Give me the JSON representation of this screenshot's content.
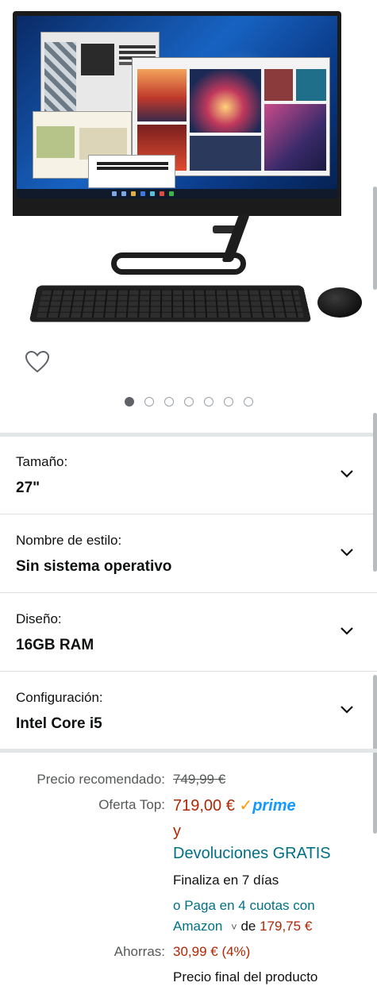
{
  "carousel": {
    "image_count": 7,
    "active_index": 0
  },
  "variations": [
    {
      "label": "Tamaño:",
      "value": "27\""
    },
    {
      "label": "Nombre de estilo:",
      "value": "Sin sistema operativo"
    },
    {
      "label": "Diseño:",
      "value": "16GB RAM"
    },
    {
      "label": "Configuración:",
      "value": "Intel Core i5"
    }
  ],
  "price": {
    "list_label": "Precio recomendado:",
    "list_price": "749,99 €",
    "deal_label": "Oferta Top:",
    "deal_price": "719,00 €",
    "prime_check": "✓",
    "prime_word": "prime",
    "and_text": "y",
    "returns_link": "Devoluciones GRATIS",
    "ends_text": "Finaliza en 7 días",
    "installments_prefix": "o",
    "installments_link_line1": "Paga en 4 cuotas con",
    "installments_link_line2": "Amazon",
    "installments_of": "de",
    "installments_amount": "179,75 €",
    "savings_label": "Ahorras:",
    "savings_value": "30,99 € (4%)",
    "final_price_text": "Precio final del producto"
  },
  "colors": {
    "price_red": "#b12704",
    "link_teal": "#007185",
    "prime_blue": "#1399ff",
    "prime_orange": "#ff9900"
  }
}
